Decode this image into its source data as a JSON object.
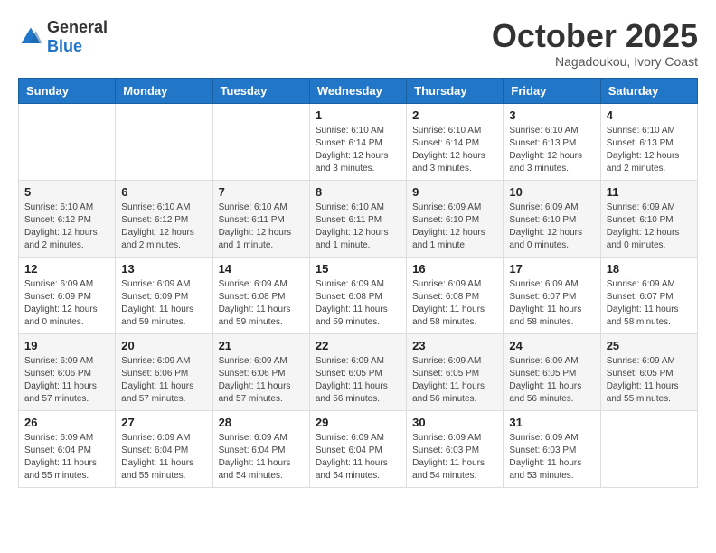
{
  "header": {
    "logo_general": "General",
    "logo_blue": "Blue",
    "month": "October 2025",
    "location": "Nagadoukou, Ivory Coast"
  },
  "weekdays": [
    "Sunday",
    "Monday",
    "Tuesday",
    "Wednesday",
    "Thursday",
    "Friday",
    "Saturday"
  ],
  "weeks": [
    [
      {
        "day": "",
        "info": ""
      },
      {
        "day": "",
        "info": ""
      },
      {
        "day": "",
        "info": ""
      },
      {
        "day": "1",
        "info": "Sunrise: 6:10 AM\nSunset: 6:14 PM\nDaylight: 12 hours and 3 minutes."
      },
      {
        "day": "2",
        "info": "Sunrise: 6:10 AM\nSunset: 6:14 PM\nDaylight: 12 hours and 3 minutes."
      },
      {
        "day": "3",
        "info": "Sunrise: 6:10 AM\nSunset: 6:13 PM\nDaylight: 12 hours and 3 minutes."
      },
      {
        "day": "4",
        "info": "Sunrise: 6:10 AM\nSunset: 6:13 PM\nDaylight: 12 hours and 2 minutes."
      }
    ],
    [
      {
        "day": "5",
        "info": "Sunrise: 6:10 AM\nSunset: 6:12 PM\nDaylight: 12 hours and 2 minutes."
      },
      {
        "day": "6",
        "info": "Sunrise: 6:10 AM\nSunset: 6:12 PM\nDaylight: 12 hours and 2 minutes."
      },
      {
        "day": "7",
        "info": "Sunrise: 6:10 AM\nSunset: 6:11 PM\nDaylight: 12 hours and 1 minute."
      },
      {
        "day": "8",
        "info": "Sunrise: 6:10 AM\nSunset: 6:11 PM\nDaylight: 12 hours and 1 minute."
      },
      {
        "day": "9",
        "info": "Sunrise: 6:09 AM\nSunset: 6:10 PM\nDaylight: 12 hours and 1 minute."
      },
      {
        "day": "10",
        "info": "Sunrise: 6:09 AM\nSunset: 6:10 PM\nDaylight: 12 hours and 0 minutes."
      },
      {
        "day": "11",
        "info": "Sunrise: 6:09 AM\nSunset: 6:10 PM\nDaylight: 12 hours and 0 minutes."
      }
    ],
    [
      {
        "day": "12",
        "info": "Sunrise: 6:09 AM\nSunset: 6:09 PM\nDaylight: 12 hours and 0 minutes."
      },
      {
        "day": "13",
        "info": "Sunrise: 6:09 AM\nSunset: 6:09 PM\nDaylight: 11 hours and 59 minutes."
      },
      {
        "day": "14",
        "info": "Sunrise: 6:09 AM\nSunset: 6:08 PM\nDaylight: 11 hours and 59 minutes."
      },
      {
        "day": "15",
        "info": "Sunrise: 6:09 AM\nSunset: 6:08 PM\nDaylight: 11 hours and 59 minutes."
      },
      {
        "day": "16",
        "info": "Sunrise: 6:09 AM\nSunset: 6:08 PM\nDaylight: 11 hours and 58 minutes."
      },
      {
        "day": "17",
        "info": "Sunrise: 6:09 AM\nSunset: 6:07 PM\nDaylight: 11 hours and 58 minutes."
      },
      {
        "day": "18",
        "info": "Sunrise: 6:09 AM\nSunset: 6:07 PM\nDaylight: 11 hours and 58 minutes."
      }
    ],
    [
      {
        "day": "19",
        "info": "Sunrise: 6:09 AM\nSunset: 6:06 PM\nDaylight: 11 hours and 57 minutes."
      },
      {
        "day": "20",
        "info": "Sunrise: 6:09 AM\nSunset: 6:06 PM\nDaylight: 11 hours and 57 minutes."
      },
      {
        "day": "21",
        "info": "Sunrise: 6:09 AM\nSunset: 6:06 PM\nDaylight: 11 hours and 57 minutes."
      },
      {
        "day": "22",
        "info": "Sunrise: 6:09 AM\nSunset: 6:05 PM\nDaylight: 11 hours and 56 minutes."
      },
      {
        "day": "23",
        "info": "Sunrise: 6:09 AM\nSunset: 6:05 PM\nDaylight: 11 hours and 56 minutes."
      },
      {
        "day": "24",
        "info": "Sunrise: 6:09 AM\nSunset: 6:05 PM\nDaylight: 11 hours and 56 minutes."
      },
      {
        "day": "25",
        "info": "Sunrise: 6:09 AM\nSunset: 6:05 PM\nDaylight: 11 hours and 55 minutes."
      }
    ],
    [
      {
        "day": "26",
        "info": "Sunrise: 6:09 AM\nSunset: 6:04 PM\nDaylight: 11 hours and 55 minutes."
      },
      {
        "day": "27",
        "info": "Sunrise: 6:09 AM\nSunset: 6:04 PM\nDaylight: 11 hours and 55 minutes."
      },
      {
        "day": "28",
        "info": "Sunrise: 6:09 AM\nSunset: 6:04 PM\nDaylight: 11 hours and 54 minutes."
      },
      {
        "day": "29",
        "info": "Sunrise: 6:09 AM\nSunset: 6:04 PM\nDaylight: 11 hours and 54 minutes."
      },
      {
        "day": "30",
        "info": "Sunrise: 6:09 AM\nSunset: 6:03 PM\nDaylight: 11 hours and 54 minutes."
      },
      {
        "day": "31",
        "info": "Sunrise: 6:09 AM\nSunset: 6:03 PM\nDaylight: 11 hours and 53 minutes."
      },
      {
        "day": "",
        "info": ""
      }
    ]
  ]
}
